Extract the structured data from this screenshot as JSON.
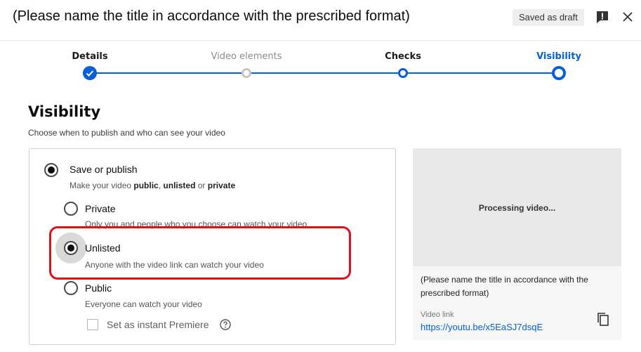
{
  "header": {
    "title": "(Please name the title in accordance with the prescribed format)",
    "draft_badge": "Saved as draft",
    "feedback_icon": "report-flag-icon",
    "close_icon": "close-icon"
  },
  "stepper": {
    "steps": [
      {
        "label": "Details",
        "state": "done"
      },
      {
        "label": "Video elements",
        "state": "inactive"
      },
      {
        "label": "Checks",
        "state": "reached"
      },
      {
        "label": "Visibility",
        "state": "current"
      }
    ],
    "colors": {
      "active": "#065fd4",
      "inactive": "#c4c4c4"
    }
  },
  "visibility": {
    "heading": "Visibility",
    "subheading": "Choose when to publish and who can see your video",
    "save_or_publish": {
      "label": "Save or publish",
      "desc_prefix": "Make your video ",
      "desc_public": "public",
      "desc_sep": ", ",
      "desc_unlisted": "unlisted",
      "desc_or": " or ",
      "desc_private": "private",
      "selected": true
    },
    "options": [
      {
        "key": "private",
        "label": "Private",
        "desc": "Only you and people who you choose can watch your video",
        "selected": false
      },
      {
        "key": "unlisted",
        "label": "Unlisted",
        "desc": "Anyone with the video link can watch your video",
        "selected": true
      },
      {
        "key": "public",
        "label": "Public",
        "desc": "Everyone can watch your video",
        "selected": false
      }
    ],
    "premiere": {
      "label": "Set as instant Premiere",
      "checked": false,
      "help_icon": "help-circle-icon"
    }
  },
  "preview": {
    "status": "Processing video...",
    "video_title": "(Please name the title in accordance with the prescribed format)",
    "link_label": "Video link",
    "link": "https://youtu.be/x5EaSJ7dsqE",
    "copy_icon": "copy-icon"
  },
  "highlight_color": "#e0101a"
}
